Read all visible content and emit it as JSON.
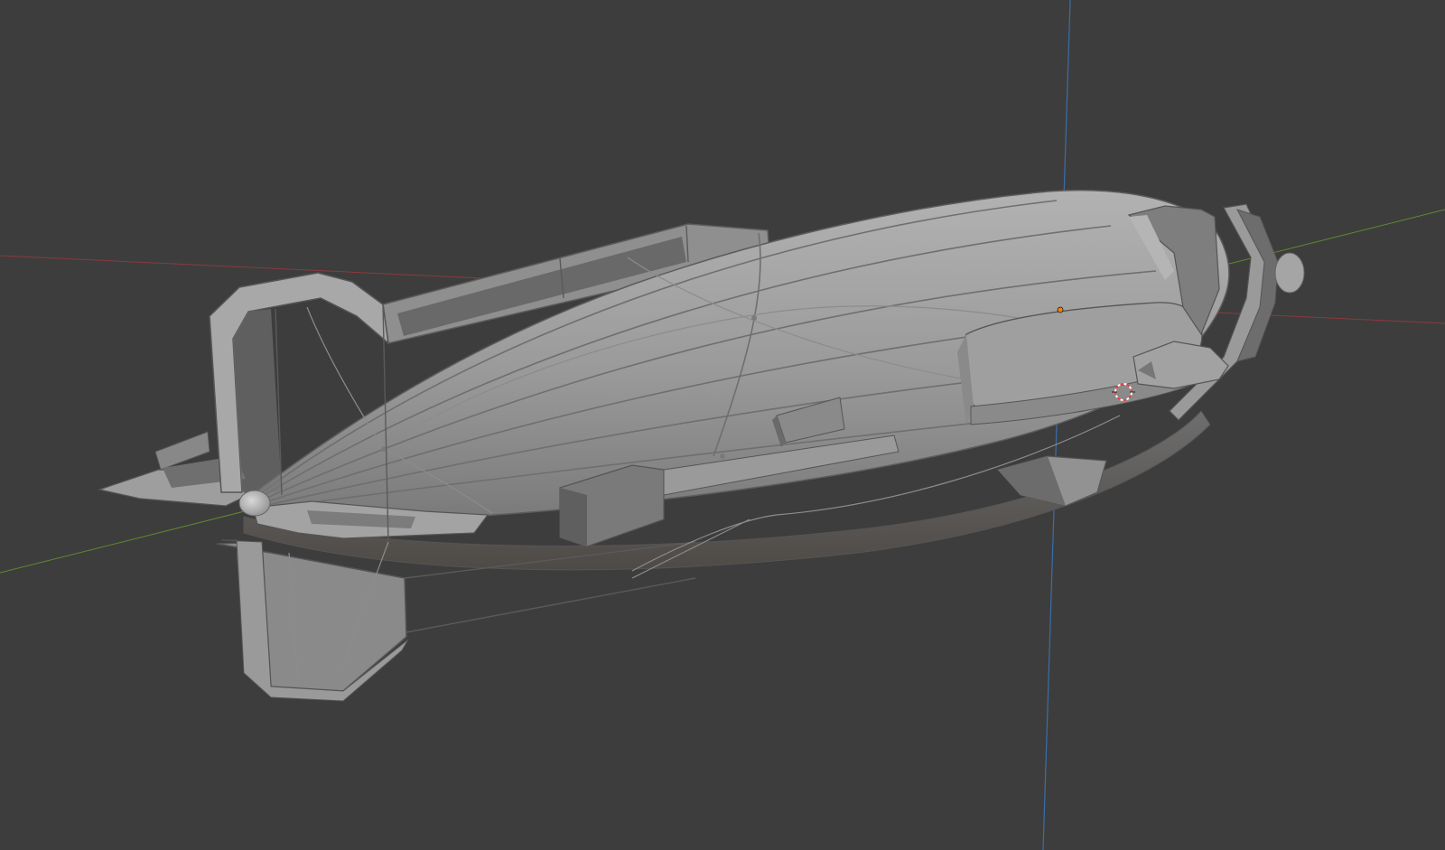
{
  "viewport": {
    "background": "#3d3d3d",
    "axis_colors": {
      "x": "#8a3a3e",
      "y": "#5f8a2e",
      "z": "#3a6ea8"
    },
    "origin_marker_color": "#f0820a",
    "cursor_colors": [
      "#e04848",
      "#ffffff"
    ],
    "object_color": "#9c9c9c"
  }
}
